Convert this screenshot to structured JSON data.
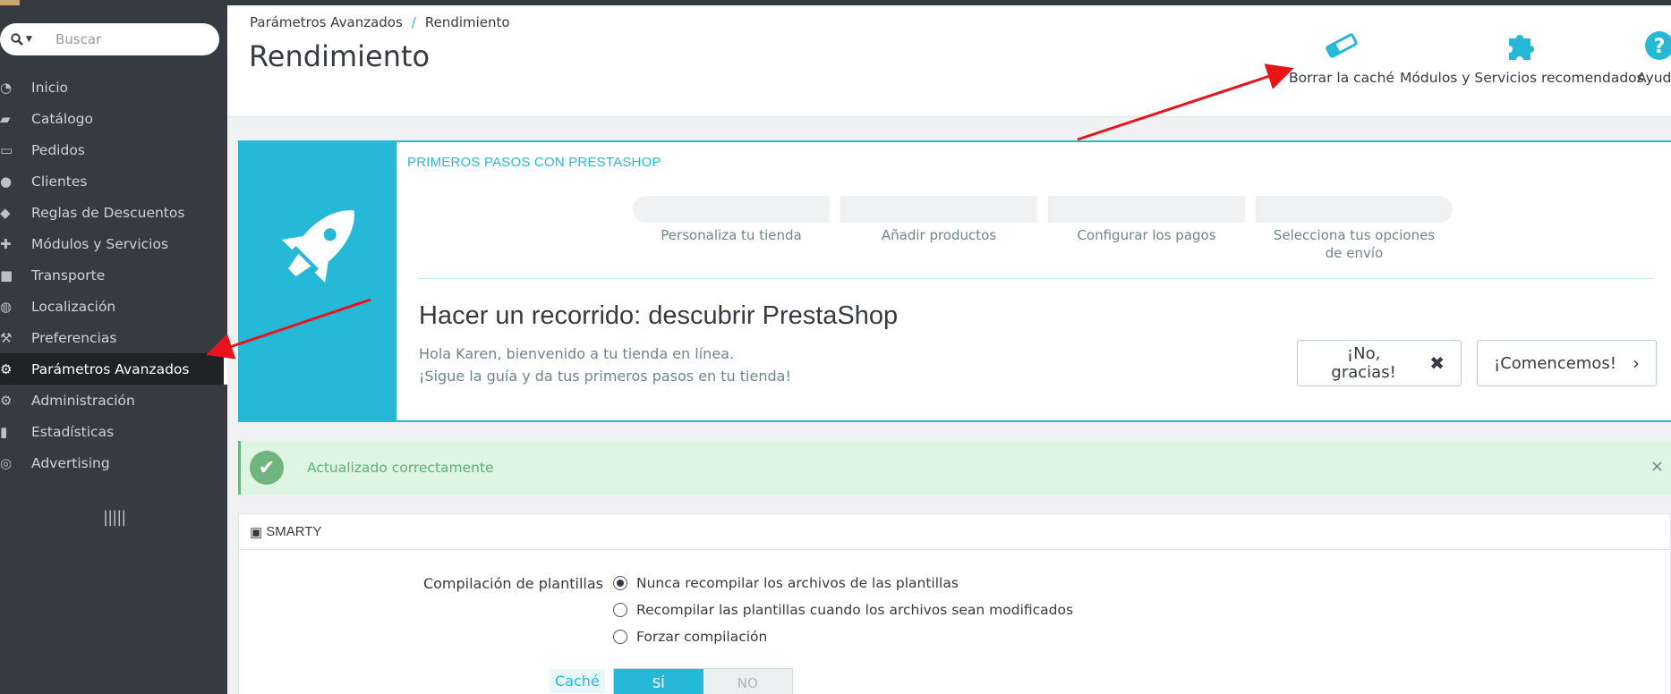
{
  "search": {
    "placeholder": "Buscar"
  },
  "sidebar": {
    "items": [
      {
        "label": "Inicio",
        "icon": "dashboard-icon"
      },
      {
        "label": "Catálogo",
        "icon": "book-icon"
      },
      {
        "label": "Pedidos",
        "icon": "credit-card-icon"
      },
      {
        "label": "Clientes",
        "icon": "users-icon"
      },
      {
        "label": "Reglas de Descuentos",
        "icon": "tags-icon"
      },
      {
        "label": "Módulos y Servicios",
        "icon": "puzzle-icon"
      },
      {
        "label": "Transporte",
        "icon": "truck-icon"
      },
      {
        "label": "Localización",
        "icon": "globe-icon"
      },
      {
        "label": "Preferencias",
        "icon": "wrench-icon"
      },
      {
        "label": "Parámetros Avanzados",
        "icon": "cogs-icon",
        "active": true
      },
      {
        "label": "Administración",
        "icon": "gear-icon"
      },
      {
        "label": "Estadísticas",
        "icon": "bar-chart-icon"
      },
      {
        "label": "Advertising",
        "icon": "bullseye-icon"
      }
    ]
  },
  "header": {
    "breadcrumb": [
      "Parámetros Avanzados",
      "Rendimiento"
    ],
    "breadcrumb_sep": "/",
    "title": "Rendimiento",
    "toolbar": {
      "clear_cache": "Borrar la caché",
      "modules": "Módulos y Servicios recomendados",
      "help": "Ayuda"
    }
  },
  "onboarding": {
    "label": "PRIMEROS PASOS CON PRESTASHOP",
    "steps": [
      "Personaliza tu tienda",
      "Añadir productos",
      "Configurar los pagos",
      "Selecciona tus opciones de envío"
    ],
    "title": "Hacer un recorrido: descubrir PrestaShop",
    "line1": "Hola Karen, bienvenido a tu tienda en línea.",
    "line2": "¡Sigue la guía y da tus primeros pasos en tu tienda!",
    "no_thanks": "¡No, gracias!",
    "start": "¡Comencemos!"
  },
  "alert": {
    "text": "Actualizado correctamente",
    "close": "×"
  },
  "smarty": {
    "title": "SMARTY",
    "compile_label": "Compilación de plantillas",
    "options": [
      "Nunca recompilar los archivos de las plantillas",
      "Recompilar las plantillas cuando los archivos sean modificados",
      "Forzar compilación"
    ],
    "selected_option": 0,
    "cache_label": "Caché",
    "cache_on": "SÍ",
    "cache_off": "NO",
    "cache_value": "SÍ"
  },
  "colors": {
    "accent": "#25b9d7",
    "sidebar": "#363a41",
    "success": "#70b580",
    "annotation": "#e8141b"
  }
}
